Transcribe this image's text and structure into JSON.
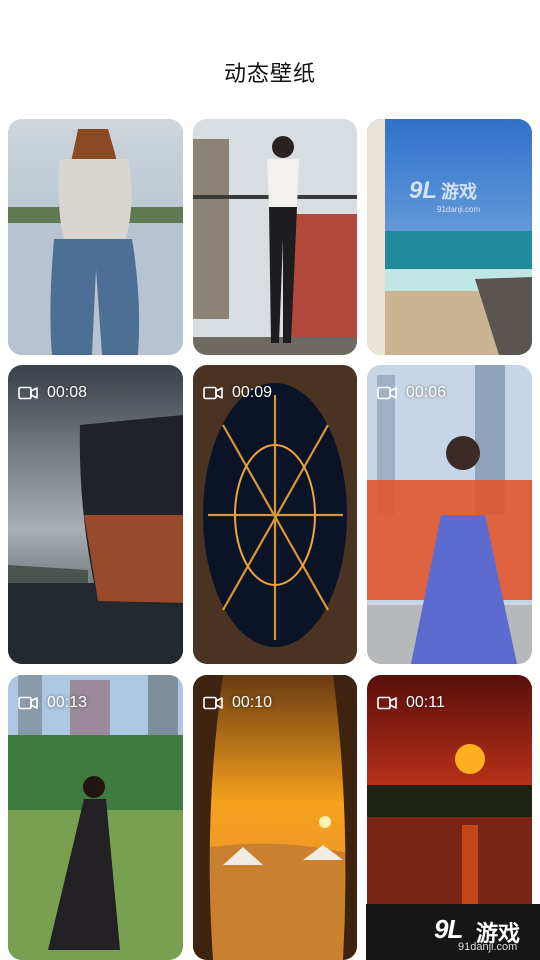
{
  "header": {
    "title": "动态壁纸"
  },
  "wallpapers": [
    {
      "kind": "image",
      "subject": "woman in jeans by lake"
    },
    {
      "kind": "image",
      "subject": "woman on balcony"
    },
    {
      "kind": "image",
      "subject": "beach seascape",
      "watermark": {
        "mark": "9L",
        "name": "游戏",
        "url": "91danji.com"
      }
    },
    {
      "kind": "video",
      "duration": "00:08",
      "subject": "cargo ship at sea"
    },
    {
      "kind": "video",
      "duration": "00:09",
      "subject": "city lights at night"
    },
    {
      "kind": "video",
      "duration": "00:06",
      "subject": "woman in purple gown"
    },
    {
      "kind": "video",
      "duration": "00:13",
      "subject": "woman dancing on lawn"
    },
    {
      "kind": "video",
      "duration": "00:10",
      "subject": "desert tents at sunset"
    },
    {
      "kind": "video",
      "duration": "00:11",
      "subject": "red sunset over lake"
    }
  ],
  "watermark": {
    "mark": "9L",
    "name": "游戏",
    "url": "91danji.com"
  },
  "colors": {
    "background": "#ffffff",
    "title": "#111111",
    "overlay_text": "#ffffff"
  }
}
